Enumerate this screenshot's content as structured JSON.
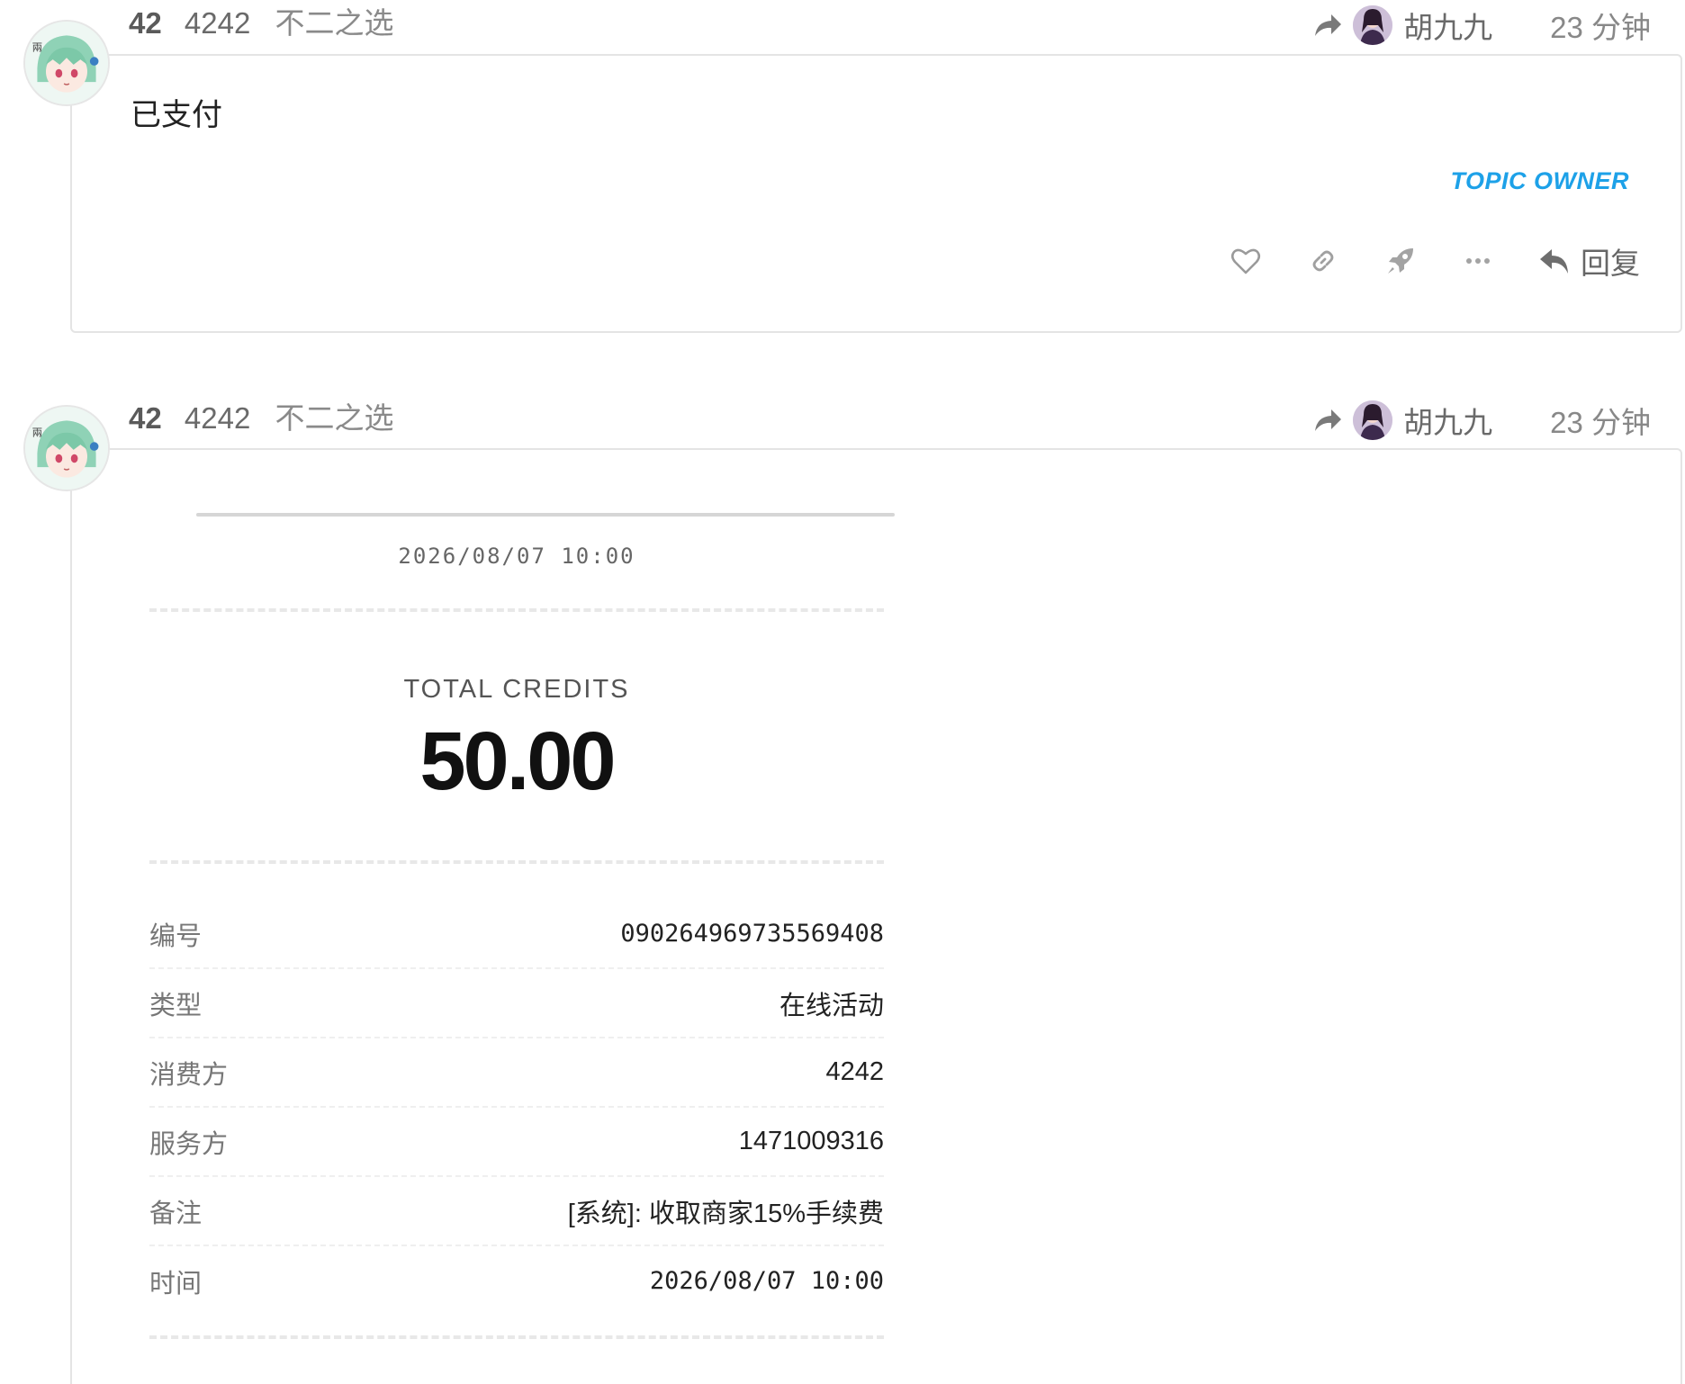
{
  "posts": [
    {
      "number": "42",
      "user_id": "4242",
      "user_title": "不二之选",
      "reply_to_name": "胡九九",
      "time": "23 分钟",
      "text": "已支付",
      "badge": "TOPIC OWNER",
      "reply_label": "回复"
    },
    {
      "number": "42",
      "user_id": "4242",
      "user_title": "不二之选",
      "reply_to_name": "胡九九",
      "time": "23 分钟"
    }
  ],
  "receipt": {
    "date_top": "2026/08/07 10:00",
    "total_label": "TOTAL CREDITS",
    "total": "50.00",
    "rows": [
      {
        "key": "编号",
        "value": "090264969735569408"
      },
      {
        "key": "类型",
        "value": "在线活动"
      },
      {
        "key": "消费方",
        "value": "4242"
      },
      {
        "key": "服务方",
        "value": "1471009316"
      },
      {
        "key": "备注",
        "value": "[系统]: 收取商家15%手续费"
      },
      {
        "key": "时间",
        "value": "2026/08/07 10:00"
      }
    ]
  },
  "colors": {
    "accent": "#1da1e8",
    "muted": "#888888",
    "border": "#e4e4e4"
  },
  "icons": [
    "share-icon",
    "heart-icon",
    "link-icon",
    "rocket-icon",
    "more-icon",
    "reply-icon"
  ]
}
